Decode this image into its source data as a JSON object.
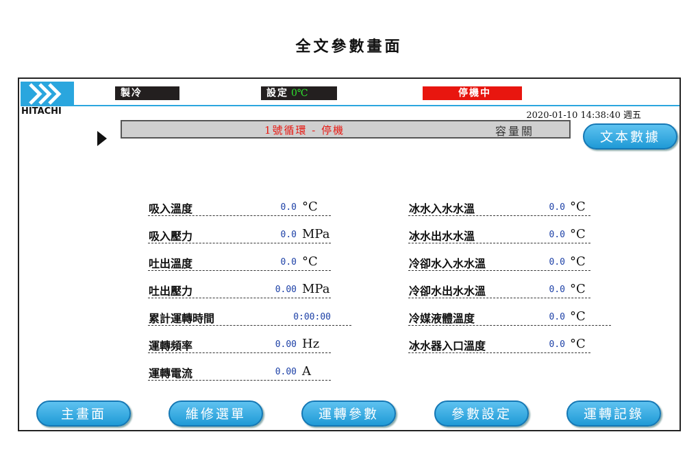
{
  "page_caption": "全文參數畫面",
  "brand": "HITACHI",
  "header": {
    "mode": "製冷",
    "setpoint_label": "設定",
    "setpoint_value": "0℃",
    "status": "停機中",
    "datetime": "2020-01-10 14:38:40 週五"
  },
  "status_bar": {
    "loop_status": "1號循環 - 停機",
    "capacity": "容量關"
  },
  "buttons": {
    "text_data": "文本數據"
  },
  "params_left": [
    {
      "label": "吸入溫度",
      "value": "0.0",
      "unit": "°C"
    },
    {
      "label": "吸入壓力",
      "value": "0.0",
      "unit": "MPa"
    },
    {
      "label": "吐出溫度",
      "value": "0.0",
      "unit": "°C"
    },
    {
      "label": "吐出壓力",
      "value": "0.00",
      "unit": "MPa"
    },
    {
      "label": "累計運轉時間",
      "value": "0:00:00",
      "unit": ""
    },
    {
      "label": "運轉頻率",
      "value": "0.00",
      "unit": "Hz"
    },
    {
      "label": "運轉電流",
      "value": "0.00",
      "unit": "A"
    }
  ],
  "params_right": [
    {
      "label": "冰水入水水溫",
      "value": "0.0",
      "unit": "°C"
    },
    {
      "label": "冰水出水水溫",
      "value": "0.0",
      "unit": "°C"
    },
    {
      "label": "冷卻水入水水溫",
      "value": "0.0",
      "unit": "°C"
    },
    {
      "label": "冷卻水出水水溫",
      "value": "0.0",
      "unit": "°C"
    },
    {
      "label": "冷媒液體溫度",
      "value": "0.0",
      "unit": "°C"
    },
    {
      "label": "冰水器入口溫度",
      "value": "0.0",
      "unit": "°C"
    }
  ],
  "nav": [
    {
      "label": "主畫面"
    },
    {
      "label": "維修選單"
    },
    {
      "label": "運轉參數"
    },
    {
      "label": "參數設定"
    },
    {
      "label": "運轉記錄"
    }
  ],
  "colors": {
    "accent": "#2aa6de",
    "status_red": "#e8160f",
    "value_blue": "#1b3fa6",
    "setpoint_green": "#2ee52e"
  }
}
